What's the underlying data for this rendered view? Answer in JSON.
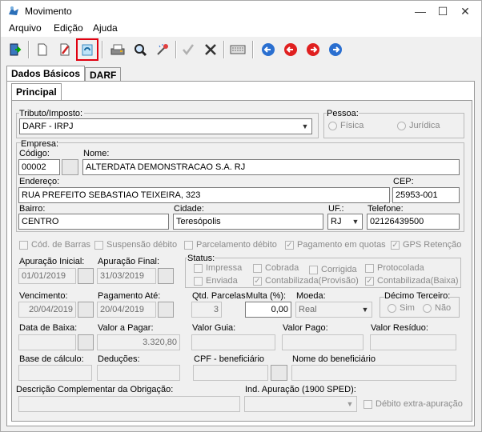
{
  "window": {
    "title": "Movimento",
    "min_icon": "minimize-icon",
    "max_icon": "maximize-icon",
    "close_icon": "close-icon"
  },
  "menu": [
    "Arquivo",
    "Edição",
    "Ajuda"
  ],
  "toolbar": {
    "icons": [
      "exit-icon",
      "new-document-icon",
      "edit-icon",
      "recycle-icon",
      "print-icon",
      "preview-icon",
      "magic-wand-icon",
      "confirm-icon",
      "cancel-icon",
      "keyboard-icon",
      "first-icon",
      "previous-icon",
      "next-icon",
      "last-icon"
    ],
    "selected": "recycle-icon"
  },
  "tabs": [
    "Dados Básicos",
    "DARF"
  ],
  "subtab": "Principal",
  "tributo": {
    "label": "Tributo/Imposto:",
    "value": "DARF - IRPJ"
  },
  "pessoa": {
    "label": "Pessoa:",
    "fisica": "Física",
    "juridica": "Jurídica"
  },
  "empresa": {
    "group": "Empresa:",
    "codigo_label": "Código:",
    "codigo": "00002",
    "nome_label": "Nome:",
    "nome": "ALTERDATA DEMONSTRACAO S.A. RJ",
    "endereco_label": "Endereço:",
    "endereco": "RUA PREFEITO SEBASTIAO TEIXEIRA, 323",
    "cep_label": "CEP:",
    "cep": "25953-001",
    "bairro_label": "Bairro:",
    "bairro": "CENTRO",
    "cidade_label": "Cidade:",
    "cidade": "Teresópolis",
    "uf_label": "UF.:",
    "uf": "RJ",
    "telefone_label": "Telefone:",
    "telefone": "02126439500"
  },
  "flags": {
    "cod_barras": "Cód. de Barras",
    "suspensao": "Suspensão débito",
    "parcelamento": "Parcelamento débito",
    "pagamento_quotas": "Pagamento em quotas",
    "gps": "GPS Retenção"
  },
  "apuracao": {
    "inicial_label": "Apuração Inicial:",
    "inicial": "01/01/2019",
    "final_label": "Apuração Final:",
    "final": "31/03/2019"
  },
  "status": {
    "label": "Status:",
    "impressa": "Impressa",
    "cobrada": "Cobrada",
    "protocolada": "Protocolada",
    "corrigida": "Corrigida",
    "enviada": "Enviada",
    "contab_prov": "Contabilizada(Provisão)",
    "contab_baixa": "Contabilizada(Baixa)"
  },
  "vencimento": {
    "label": "Vencimento:",
    "value": "20/04/2019"
  },
  "pagamento_ate": {
    "label": "Pagamento Até:",
    "value": "20/04/2019"
  },
  "qtd_parcelas": {
    "label": "Qtd. Parcelas",
    "value": "3"
  },
  "multa": {
    "label": "Multa (%):",
    "value": "0,00"
  },
  "moeda": {
    "label": "Moeda:",
    "value": "Real"
  },
  "decimo": {
    "label": "Décimo Terceiro:",
    "sim": "Sim",
    "nao": "Não"
  },
  "data_baixa": {
    "label": "Data de Baixa:"
  },
  "valor_pagar": {
    "label": "Valor a Pagar:",
    "value": "3.320,80"
  },
  "valor_guia": {
    "label": "Valor Guia:"
  },
  "valor_pago": {
    "label": "Valor Pago:"
  },
  "valor_residuo": {
    "label": "Valor Resíduo:"
  },
  "base_calculo": {
    "label": "Base de cálculo:"
  },
  "deducoes": {
    "label": "Deduções:"
  },
  "cpf_beneficiario": {
    "label": "CPF - beneficiário"
  },
  "nome_beneficiario": {
    "label": "Nome do beneficiário"
  },
  "descricao": {
    "label": "Descrição Complementar da Obrigação:"
  },
  "ind_apuracao": {
    "label": "Ind. Apuração (1900 SPED):"
  },
  "debito_extra": {
    "label": "Débito extra-apuração"
  }
}
